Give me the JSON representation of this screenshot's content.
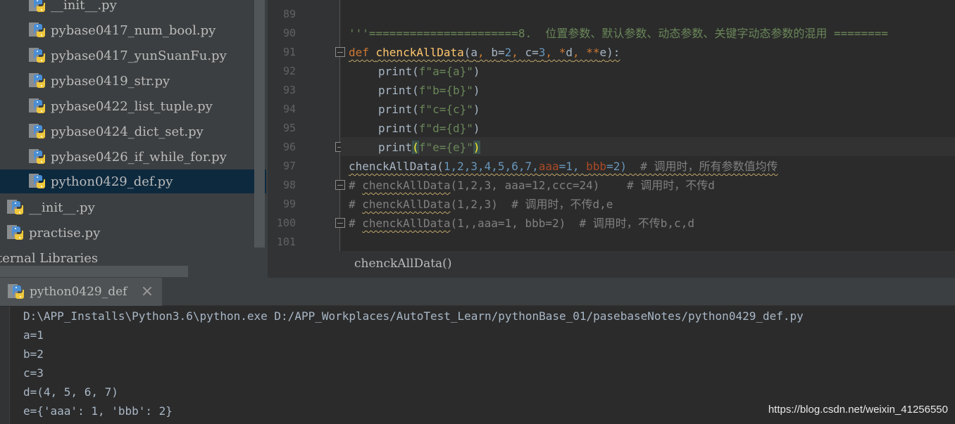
{
  "project_tree": {
    "items": [
      {
        "label": "__init__.py"
      },
      {
        "label": "pybase0417_num_bool.py"
      },
      {
        "label": "pybase0417_yunSuanFu.py"
      },
      {
        "label": "pybase0419_str.py"
      },
      {
        "label": "pybase0422_list_tuple.py"
      },
      {
        "label": "pybase0424_dict_set.py"
      },
      {
        "label": "pybase0426_if_while_for.py"
      },
      {
        "label": "python0429_def.py"
      },
      {
        "label": "__init__.py"
      },
      {
        "label": "practise.py"
      },
      {
        "label": "ternal Libraries"
      }
    ]
  },
  "editor": {
    "line_numbers": [
      "89",
      "90",
      "91",
      "92",
      "93",
      "94",
      "95",
      "96",
      "97",
      "98",
      "99",
      "100",
      "101"
    ],
    "code": {
      "l90": "'''======================8.  位置参数、默认参数、动态参数、关键字动态参数的混用 ========",
      "l91_def": "def ",
      "l91_name": "chenckAllData",
      "l91_open": "(",
      "l91_a": "a",
      "l91_sep1": ", ",
      "l91_b": "b",
      "l91_eq1": "=",
      "l91_n2": "2",
      "l91_sep2": ", ",
      "l91_c": "c",
      "l91_eq2": "=",
      "l91_n3": "3",
      "l91_sep3": ", *",
      "l91_d": "d",
      "l91_sep4": ", **",
      "l91_e": "e",
      "l91_close": "):",
      "l92_print": "print(",
      "l92_str": "f\"a={a}\"",
      "l92_close": ")",
      "l93_print": "print(",
      "l93_str": "f\"b={b}\"",
      "l93_close": ")",
      "l94_print": "print(",
      "l94_str": "f\"c={c}\"",
      "l94_close": ")",
      "l95_print": "print(",
      "l95_str": "f\"d={d}\"",
      "l95_close": ")",
      "l96_print": "print",
      "l96_open": "(",
      "l96_str": "f\"e={e}\"",
      "l96_close": ")",
      "l97_call": "chenckAllData(",
      "l97_args_nums": "1,2,3,4,5,6,7,",
      "l97_k1": "aaa",
      "l97_v1": "=1, ",
      "l97_k2": "bbb",
      "l97_v2": "=2)",
      "l97_comment": "  # 调用时，所有参数值均传",
      "l98_hash": "# ",
      "l98_call": "chenckAllData",
      "l98_rest": "(1,2,3, aaa=12,ccc=24)    # 调用时，不传d",
      "l99_hash": "# ",
      "l99_call": "chenckAllData",
      "l99_rest": "(1,2,3)  # 调用时，不传d,e",
      "l100_hash": "# ",
      "l100_call": "chenckAllData",
      "l100_rest": "(1,,aaa=1, bbb=2)  # 调用时，不传b,c,d"
    },
    "breadcrumb": "chenckAllData()"
  },
  "run_panel": {
    "tab_label": "python0429_def",
    "close_glyph": "×",
    "console_lines": [
      "D:\\APP_Installs\\Python3.6\\python.exe D:/APP_Workplaces/AutoTest_Learn/pythonBase_01/pasebaseNotes/python0429_def.py",
      "a=1",
      "b=2",
      "c=3",
      "d=(4, 5, 6, 7)",
      "e={'aaa': 1, 'bbb': 2}"
    ]
  },
  "watermark": "https://blog.csdn.net/weixin_41256550",
  "colors": {
    "keyword": "#cc7832",
    "function": "#ffc66d",
    "number": "#6897bb",
    "string": "#6a8759",
    "comment": "#808080",
    "selection": "#0d293e"
  }
}
